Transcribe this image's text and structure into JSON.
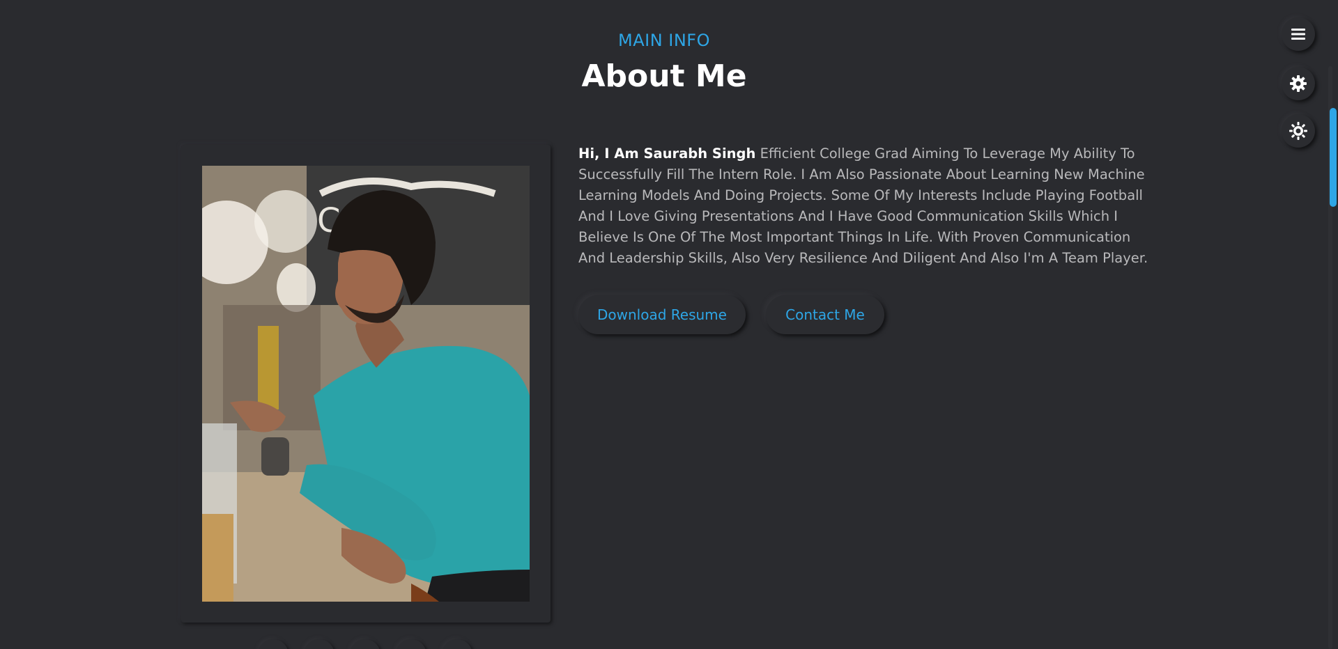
{
  "section": {
    "subtitle": "MAIN INFO",
    "title": "About Me"
  },
  "about": {
    "greeting": "Hi, I Am Saurabh Singh",
    "description": "Efficient College Grad Aiming To Leverage My Ability To Successfully Fill The Intern Role. I Am Also Passionate About Learning New Machine Learning Models And Doing Projects. Some Of My Interests Include Playing Football And I Love Giving Presentations And I Have Good Communication Skills Which I Believe Is One Of The Most Important Things In Life. With Proven Communication And Leadership Skills, Also Very Resilience And Diligent And Also I'm A Team Player."
  },
  "buttons": {
    "download": "Download Resume",
    "contact": "Contact Me"
  },
  "side_controls": [
    {
      "name": "menu",
      "icon": "hamburger-menu-icon"
    },
    {
      "name": "settings",
      "icon": "gear-icon"
    },
    {
      "name": "theme",
      "icon": "sun-icon"
    }
  ],
  "social_links": [
    {
      "icon": "social-icon"
    },
    {
      "icon": "social-icon"
    },
    {
      "icon": "social-icon"
    },
    {
      "icon": "social-icon"
    },
    {
      "icon": "social-icon"
    }
  ],
  "colors": {
    "background": "#2a2b2f",
    "accent": "#2ea6e6",
    "text": "#b9b9bb",
    "heading": "#ffffff"
  }
}
